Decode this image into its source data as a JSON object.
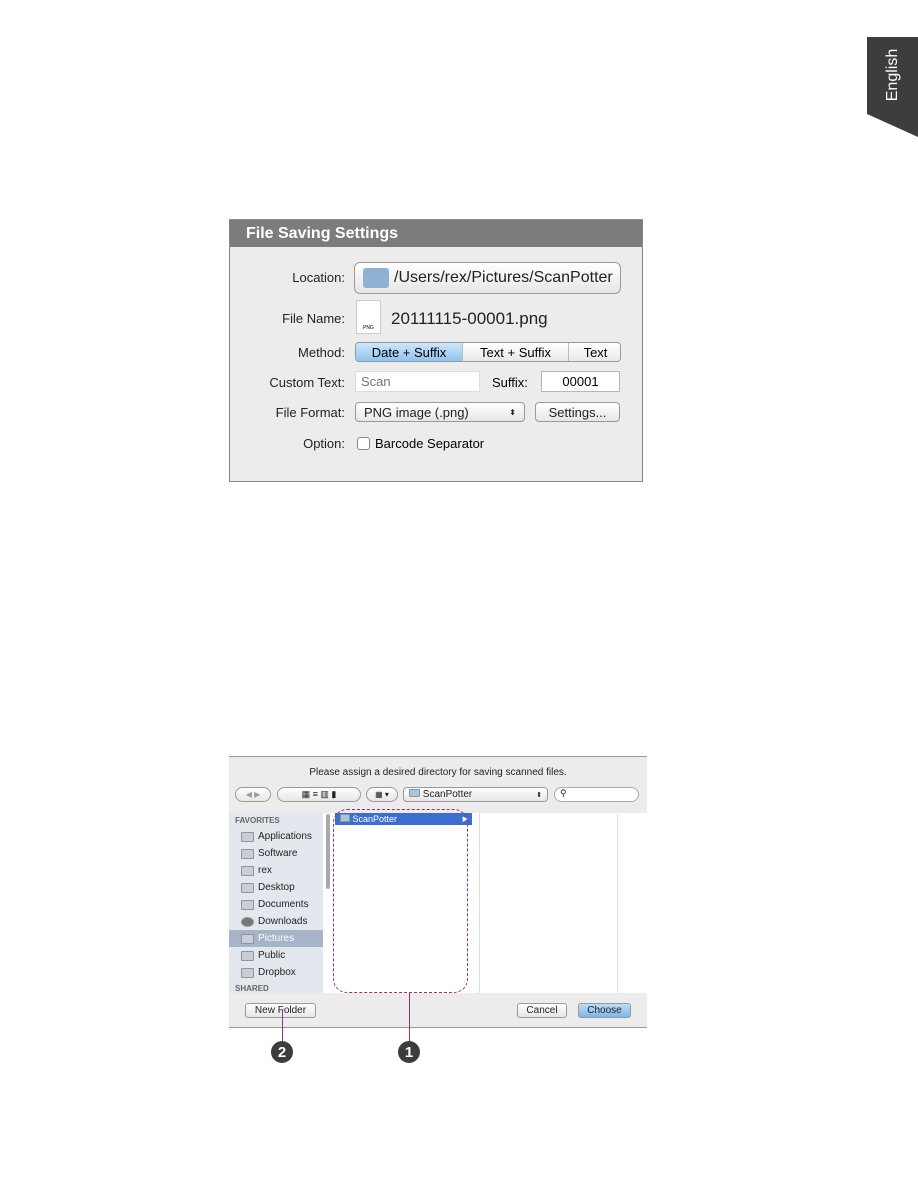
{
  "side_tab": {
    "label": "English"
  },
  "file_saving": {
    "title": "File Saving Settings",
    "location_label": "Location:",
    "location_value": "/Users/rex/Pictures/ScanPotter",
    "file_name_label": "File Name:",
    "file_name_value": "20111115-00001.png",
    "file_icon_text": "PNG",
    "method_label": "Method:",
    "methods": [
      "Date + Suffix",
      "Text + Suffix",
      "Text"
    ],
    "method_selected": "Date + Suffix",
    "custom_text_label": "Custom Text:",
    "custom_text_placeholder": "Scan",
    "suffix_label": "Suffix:",
    "suffix_value": "00001",
    "file_format_label": "File Format:",
    "file_format_value": "PNG image (.png)",
    "settings_button": "Settings...",
    "option_label": "Option:",
    "barcode_label": "Barcode Separator",
    "barcode_checked": false
  },
  "chooser": {
    "message": "Please assign a desired directory for saving scanned files.",
    "path_popup": "ScanPotter",
    "search_placeholder": "",
    "favorites_header": "FAVORITES",
    "shared_header": "SHARED",
    "favorites": [
      {
        "label": "Applications",
        "icon": "applications-icon"
      },
      {
        "label": "Software",
        "icon": "folder-icon"
      },
      {
        "label": "rex",
        "icon": "home-icon"
      },
      {
        "label": "Desktop",
        "icon": "desktop-icon"
      },
      {
        "label": "Documents",
        "icon": "documents-icon"
      },
      {
        "label": "Downloads",
        "icon": "downloads-icon"
      },
      {
        "label": "Pictures",
        "icon": "camera-icon"
      },
      {
        "label": "Public",
        "icon": "folder-icon"
      },
      {
        "label": "Dropbox",
        "icon": "folder-icon"
      }
    ],
    "selected_favorite": "Pictures",
    "column_item": "ScanPotter",
    "new_folder_button": "New Folder",
    "cancel_button": "Cancel",
    "choose_button": "Choose",
    "callouts": [
      "1",
      "2"
    ],
    "callout_color": "#9b2d7f"
  }
}
